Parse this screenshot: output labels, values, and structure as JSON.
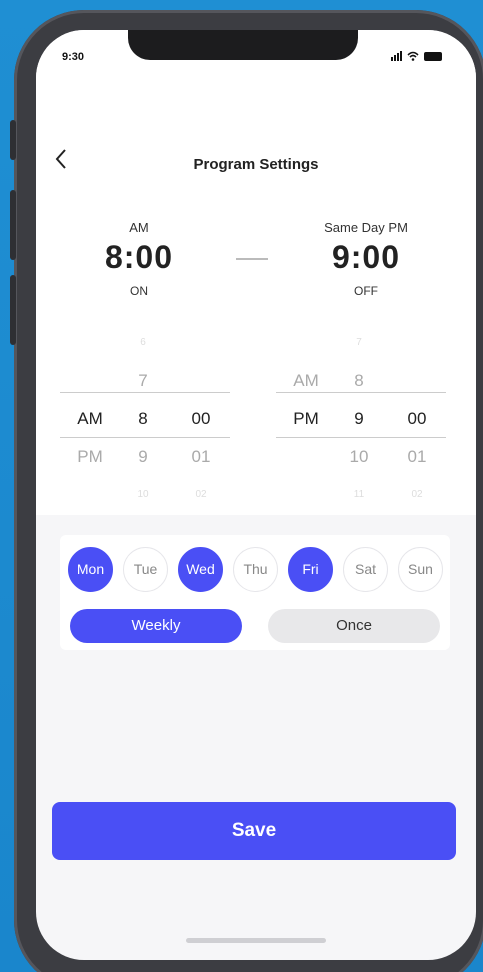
{
  "status": {
    "time": "9:30"
  },
  "header": {
    "back_icon": "chevron-left-icon",
    "title": "Program Settings"
  },
  "start": {
    "period": "AM",
    "time": "8:00",
    "state": "ON"
  },
  "end": {
    "period": "Same Day PM",
    "time": "9:00",
    "state": "OFF"
  },
  "picker_left": {
    "period": [
      "",
      "",
      "AM",
      "PM",
      ""
    ],
    "hour": [
      "6",
      "7",
      "8",
      "9",
      "10"
    ],
    "minute": [
      "",
      "",
      "00",
      "01",
      "02"
    ]
  },
  "picker_right": {
    "period": [
      "",
      "AM",
      "PM",
      "",
      ""
    ],
    "hour": [
      "7",
      "8",
      "9",
      "10",
      "11"
    ],
    "minute": [
      "",
      "",
      "00",
      "01",
      "02"
    ]
  },
  "days": [
    {
      "label": "Mon",
      "active": true
    },
    {
      "label": "Tue",
      "active": false
    },
    {
      "label": "Wed",
      "active": true
    },
    {
      "label": "Thu",
      "active": false
    },
    {
      "label": "Fri",
      "active": true
    },
    {
      "label": "Sat",
      "active": false
    },
    {
      "label": "Sun",
      "active": false
    }
  ],
  "repeat": {
    "weekly_label": "Weekly",
    "once_label": "Once",
    "selected": "Weekly"
  },
  "save_label": "Save",
  "colors": {
    "accent": "#4a4ff5",
    "background": "#1f8fd3"
  }
}
